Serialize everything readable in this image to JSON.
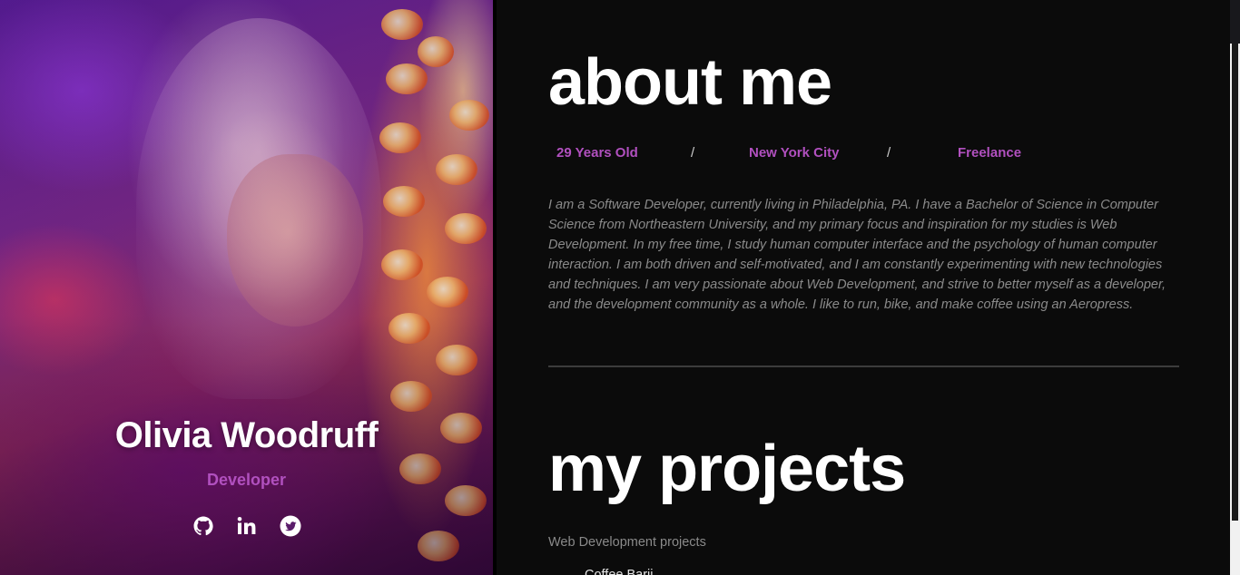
{
  "hero": {
    "name": "Olivia Woodruff",
    "role": "Developer",
    "social": [
      {
        "icon": "github-icon",
        "label": "GitHub"
      },
      {
        "icon": "linkedin-icon",
        "label": "LinkedIn"
      },
      {
        "icon": "twitter-icon",
        "label": "Twitter"
      }
    ]
  },
  "about": {
    "heading": "about me",
    "facts": {
      "age": "29 Years Old",
      "separator": "/",
      "city": "New York City",
      "status": "Freelance"
    },
    "bio": "I am a Software Developer, currently living in Philadelphia, PA. I have a Bachelor of Science in Computer Science from Northeastern University, and my primary focus and inspiration for my studies is Web Development. In my free time, I study human computer interface and the psychology of human computer interaction. I am both driven and self-motivated, and I am constantly experimenting with new technologies and techniques. I am very passionate about Web Development, and strive to better myself as a developer, and the development community as a whole. I like to run, bike, and make coffee using an Aeropress."
  },
  "projects": {
    "heading": "my projects",
    "subheading": "Web Development projects",
    "items": [
      "Coffee Barii"
    ]
  },
  "colors": {
    "accent": "#b150bf",
    "background": "#0b0b0b",
    "heading": "#ffffff",
    "body_text": "#8a8a8a"
  }
}
